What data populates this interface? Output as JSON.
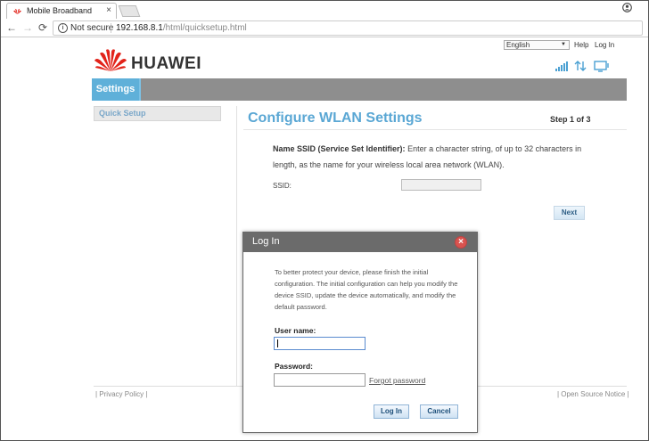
{
  "browser": {
    "tab_title": "Mobile Broadband",
    "tab_close": "×",
    "not_secure": "Not secure",
    "url_host": "192.168.8.1",
    "url_path": "/html/quicksetup.html",
    "info_glyph": "i"
  },
  "header": {
    "language": "English",
    "help_link": "Help",
    "login_link": "Log In",
    "brand": "HUAWEI"
  },
  "menu": {
    "settings": "Settings"
  },
  "sidebar": {
    "items": [
      {
        "label": "Quick Setup"
      }
    ]
  },
  "main": {
    "title": "Configure WLAN Settings",
    "step": "Step 1 of 3",
    "desc_bold": "Name SSID (Service Set Identifier):",
    "desc_rest": " Enter a character string, of up to 32 characters in length, as the name for your wireless local area network (WLAN).",
    "ssid_label": "SSID:",
    "next_button": "Next"
  },
  "footer": {
    "privacy": "| Privacy Policy |",
    "open_source": "| Open Source Notice |"
  },
  "dialog": {
    "title": "Log In",
    "close_glyph": "×",
    "message": "To better protect your device, please finish the initial configuration. The initial configuration can help you modify the device SSID, update the device automatically, and modify the default password.",
    "username_label": "User name:",
    "username_value": "",
    "password_label": "Password:",
    "password_value": "",
    "forgot_link": "Forgot password",
    "login_button": "Log In",
    "cancel_button": "Cancel"
  },
  "colors": {
    "brand_red": "#e2231a",
    "accent_blue": "#5aa7d4",
    "menu_gray": "#8e8e8e",
    "dialog_header": "#6b6b6b"
  }
}
